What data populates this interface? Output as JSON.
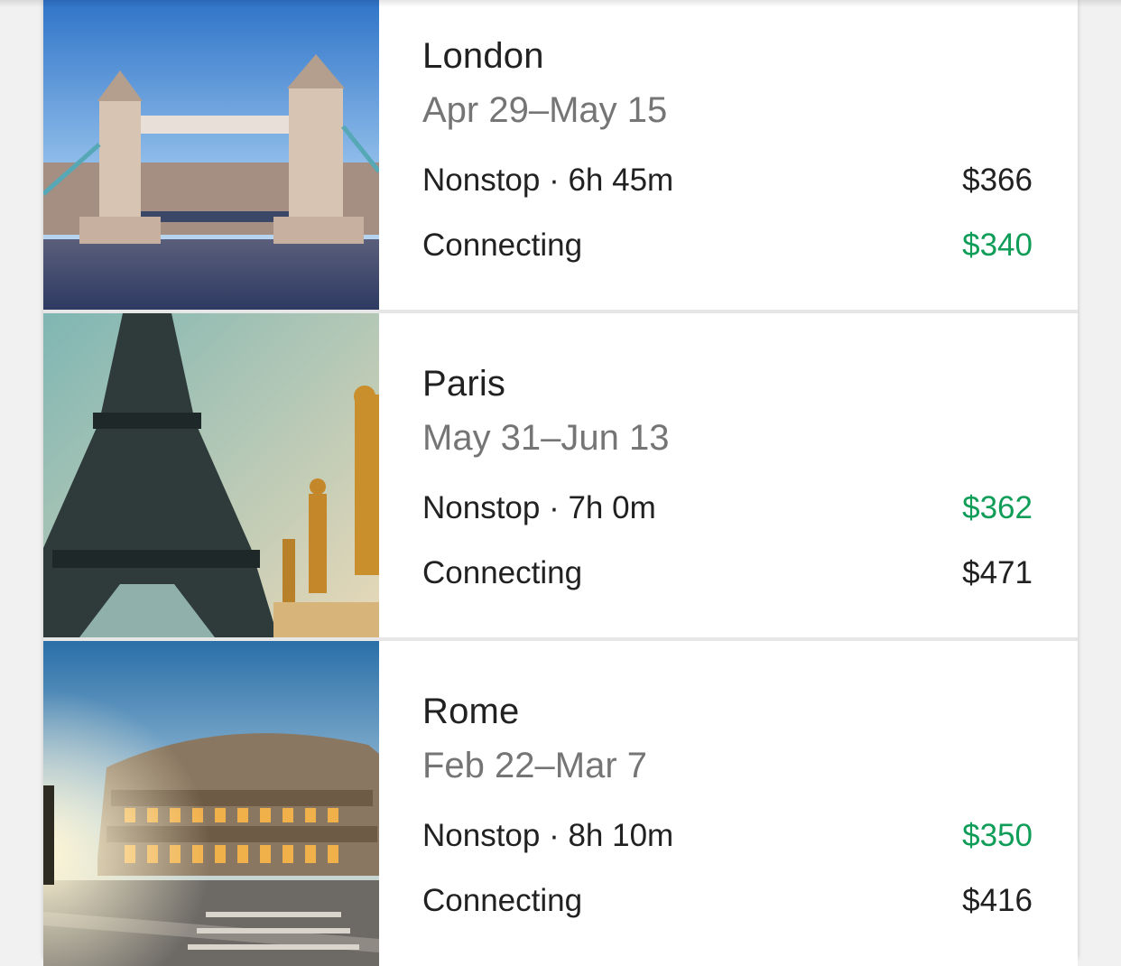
{
  "destinations": [
    {
      "city": "London",
      "dates": "Apr 29–May 15",
      "photo_icon": "tower-bridge-photo",
      "nonstop": {
        "label": "Nonstop · 6h 45m",
        "price": "$366",
        "best": false
      },
      "connecting": {
        "label": "Connecting",
        "price": "$340",
        "best": true
      }
    },
    {
      "city": "Paris",
      "dates": "May 31–Jun 13",
      "photo_icon": "eiffel-tower-photo",
      "nonstop": {
        "label": "Nonstop · 7h 0m",
        "price": "$362",
        "best": true
      },
      "connecting": {
        "label": "Connecting",
        "price": "$471",
        "best": false
      }
    },
    {
      "city": "Rome",
      "dates": "Feb 22–Mar 7",
      "photo_icon": "colosseum-photo",
      "nonstop": {
        "label": "Nonstop · 8h 10m",
        "price": "$350",
        "best": true
      },
      "connecting": {
        "label": "Connecting",
        "price": "$416",
        "best": false
      }
    }
  ],
  "colors": {
    "best_price": "#0f9d58",
    "primary_text": "#212121",
    "secondary_text": "#757575"
  }
}
